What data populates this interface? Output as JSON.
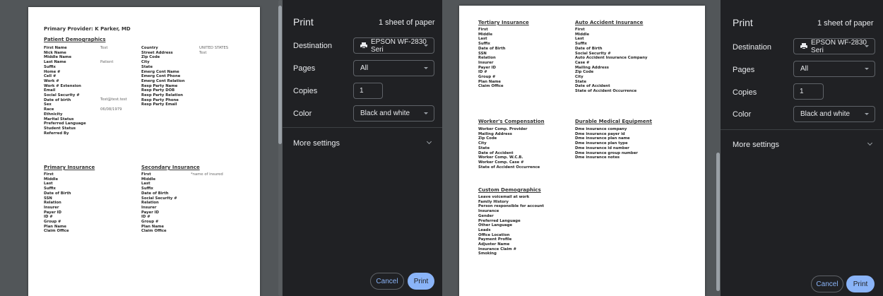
{
  "left_preview": {
    "provider": "Primary Provider: K Parker, MD",
    "demo_title": "Patient Demographics",
    "demo_col1": [
      "First Name",
      "Nick Name",
      "Middle Name",
      "Last Name",
      "Suffix",
      "Home #",
      "Cell #",
      "Work #",
      "Work # Extension",
      "Email",
      "Social Security #",
      "Date of birth",
      "Sex",
      "Race",
      "Ethnicity",
      "Marital Status",
      "Preferred Language",
      "Student Status",
      "Referred By"
    ],
    "demo_vals1": {
      "first": "Test",
      "last": "Patient",
      "email": "Test@test.test",
      "dob": "06/08/1979"
    },
    "demo_col2": [
      "Country",
      "Street Address",
      "Zip Code",
      "City",
      "State",
      "Emerg Cont Name",
      "Emerg Cont Phone",
      "Emerg Cont Relation",
      "Resp Party Name",
      "Resp Party DOB",
      "Resp Party Relation",
      "Resp Party Phone",
      "Resp Party Email"
    ],
    "demo_vals2": {
      "country": "UNITED STATES",
      "street": "Test"
    },
    "primary_title": "Primary Insurance",
    "primary_fields": [
      "First",
      "Middle",
      "Last",
      "Suffix",
      "Date of Birth",
      "SSN",
      "Relation",
      "Insurer",
      "Payer ID",
      "ID #",
      "Group #",
      "Plan Name",
      "Claim Office"
    ],
    "secondary_title": "Secondary Insurance",
    "secondary_fields": [
      "First",
      "Middle",
      "Last",
      "Suffix",
      "Date of Birth",
      "Social Security #",
      "Relation",
      "Insurer",
      "Payer ID",
      "ID #",
      "Group #",
      "Plan Name",
      "Claim Office"
    ],
    "secondary_note": "*name of insured"
  },
  "right_preview": {
    "tertiary_title": "Tertiary Insurance",
    "tertiary_fields": [
      "First",
      "Middle",
      "Last",
      "Suffix",
      "Date of Birth",
      "SSN",
      "Relation",
      "Insurer",
      "Payer ID",
      "ID #",
      "Group #",
      "Plan Name",
      "Claim Office"
    ],
    "auto_title": "Auto Accident Insurance",
    "auto_fields": [
      "First",
      "Middle",
      "Last",
      "Suffix",
      "Date of Birth",
      "Social Security #",
      "Auto Accident Insurance Company",
      "Case #",
      "Mailing Address",
      "Zip Code",
      "City",
      "State",
      "Date of Accident",
      "State of Accident Occurrence"
    ],
    "workers_title": "Worker's Compensation",
    "workers_fields": [
      "Worker Comp. Provider",
      "Mailing Address",
      "Zip Code",
      "City",
      "State",
      "Date of Accident",
      "Worker Comp. W.C.B.",
      "Worker Comp. Case #",
      "State of Accident Occurrence"
    ],
    "dme_title": "Durable Medical Equipment",
    "dme_fields": [
      "Dme insurance company",
      "Dme insurance payer id",
      "Dme insurance plan name",
      "Dme insurance plan type",
      "Dme insurance id number",
      "Dme insurance group number",
      "Dme insurance notes"
    ],
    "custom_title": "Custom Demographics",
    "custom_fields": [
      "Leave voicemail at work",
      "Family History",
      "Person responsible for account",
      "Insurance",
      "Gender",
      "Preferred Language",
      "Other Language",
      "Leads",
      "Office Location",
      "Payment Profile",
      "Adjuster Name",
      "Insurance Claim #",
      "Smoking"
    ]
  },
  "dialog": {
    "title": "Print",
    "sheet_count": "1 sheet of paper",
    "destination_label": "Destination",
    "destination_value": "EPSON WF-2830 Seri",
    "pages_label": "Pages",
    "pages_value": "All",
    "copies_label": "Copies",
    "copies_value": "1",
    "color_label": "Color",
    "color_value": "Black and white",
    "more_settings": "More settings",
    "cancel": "Cancel",
    "print": "Print"
  },
  "colors": {
    "dialog_bg": "#202124",
    "preview_bg": "#525659",
    "accent": "#8ab4f8"
  },
  "icons": [
    "printer-icon",
    "chevron-down-icon",
    "dropdown-caret-icon"
  ]
}
